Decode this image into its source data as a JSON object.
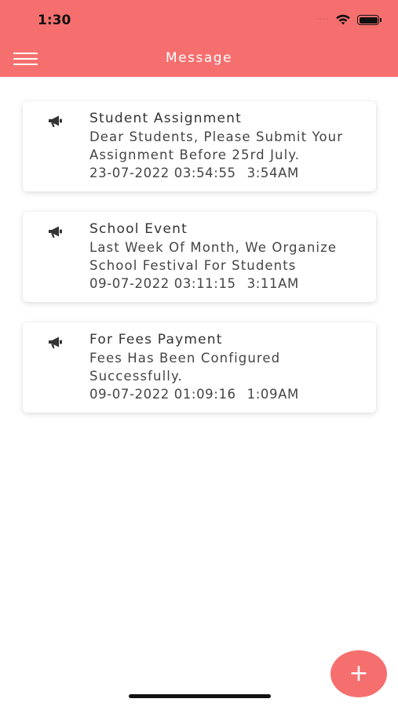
{
  "status_bar": {
    "time": "1:30",
    "signal_dots": "····"
  },
  "header": {
    "title": "Message",
    "menu_icon": "hamburger-menu-icon"
  },
  "messages": [
    {
      "title": "Student Assignment",
      "body": "Dear Students, Please Submit Your Assignment Before 25rd July.",
      "datetime": "23-07-2022 03:54:55",
      "time": "3:54AM",
      "icon": "megaphone-icon"
    },
    {
      "title": "School Event",
      "body": "Last Week Of Month, We Organize School Festival For Students",
      "datetime": "09-07-2022 03:11:15",
      "time": "3:11AM",
      "icon": "megaphone-icon"
    },
    {
      "title": "For Fees Payment",
      "body": "Fees Has Been Configured Successfully.",
      "datetime": "09-07-2022 01:09:16",
      "time": "1:09AM",
      "icon": "megaphone-icon"
    }
  ],
  "fab": {
    "label": "+",
    "icon": "plus-icon"
  },
  "colors": {
    "accent": "#f66f6f",
    "background": "#ffffff",
    "text": "#444444"
  }
}
